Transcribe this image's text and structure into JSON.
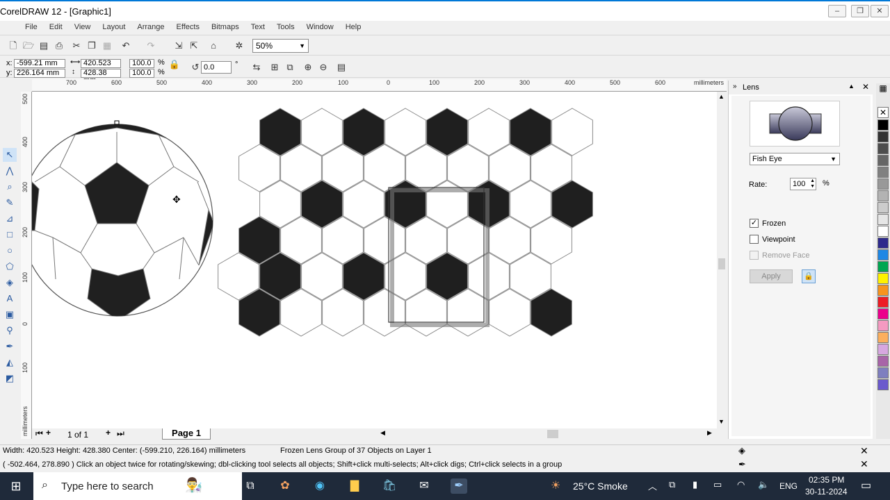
{
  "window": {
    "title": "CorelDRAW 12 - [Graphic1]",
    "controls": {
      "minimize": "–",
      "restore": "❐",
      "close": "✕"
    }
  },
  "menu": {
    "items": [
      "File",
      "Edit",
      "View",
      "Layout",
      "Arrange",
      "Effects",
      "Bitmaps",
      "Text",
      "Tools",
      "Window",
      "Help"
    ]
  },
  "toolbar": {
    "zoom": "50%"
  },
  "property_bar": {
    "x_label": "x:",
    "x_value": "-599.21 mm",
    "y_label": "y:",
    "y_value": "226.164 mm",
    "width": "420.523 mm",
    "height": "428.38 mm",
    "scale_x": "100.0",
    "scale_y": "100.0",
    "percent": "%",
    "rotation": "0.0",
    "degree": "°"
  },
  "rulers": {
    "horizontal_ticks": [
      "700",
      "600",
      "500",
      "400",
      "300",
      "200",
      "100",
      "0",
      "100",
      "200",
      "300",
      "400",
      "500",
      "600"
    ],
    "horizontal_unit": "millimeters",
    "vertical_ticks": [
      "500",
      "400",
      "300",
      "200",
      "100",
      "0",
      "100"
    ],
    "vertical_unit": "millimeters"
  },
  "page_nav": {
    "counter": "1 of 1",
    "tab": "Page 1"
  },
  "lens_docker": {
    "title": "Lens",
    "effect": "Fish Eye",
    "rate_label": "Rate:",
    "rate_value": "100",
    "rate_unit": "%",
    "frozen_label": "Frozen",
    "frozen_checked": true,
    "viewpoint_label": "Viewpoint",
    "viewpoint_checked": false,
    "remove_face_label": "Remove Face",
    "remove_face_checked": false,
    "apply_label": "Apply"
  },
  "palette": {
    "colors": [
      "#000000",
      "#333333",
      "#4d4d4d",
      "#666666",
      "#808080",
      "#999999",
      "#b3b3b3",
      "#cccccc",
      "#e6e6e6",
      "#ffffff",
      "#2e2a8c",
      "#1e88e5",
      "#00a651",
      "#fff200",
      "#f7941d",
      "#ed1c24",
      "#ec008c",
      "#f49ac1",
      "#fbaf5d",
      "#d7a7e0",
      "#a864a8",
      "#7f7fbf",
      "#6a5acd"
    ]
  },
  "status": {
    "line1_left": "Width: 420.523  Height: 428.380  Center: (-599.210, 226.164)  millimeters",
    "line1_right": "Frozen Lens Group of 37 Objects on Layer 1",
    "line2": "( -502.464, 278.890 )   Click an object twice for rotating/skewing; dbl-clicking tool selects all objects; Shift+click multi-selects; Alt+click digs; Ctrl+click selects in a group"
  },
  "taskbar": {
    "search_placeholder": "Type here to search",
    "weather": "25°C  Smoke",
    "language": "ENG",
    "time": "02:35 PM",
    "date": "30-11-2024"
  }
}
